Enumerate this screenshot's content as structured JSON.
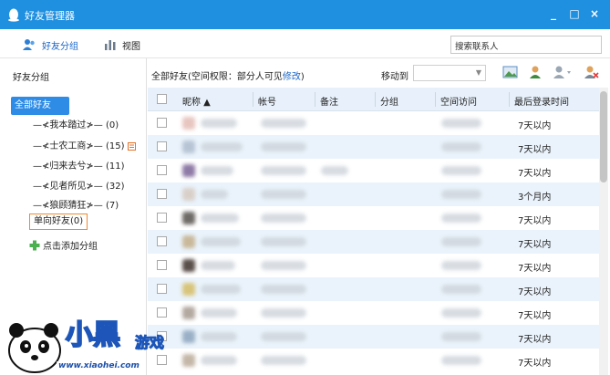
{
  "window": {
    "title": "好友管理器",
    "minimize": "_",
    "maximize": "□",
    "close": "×"
  },
  "toolbar": {
    "group_label": "好友分组",
    "view_label": "视图",
    "search_placeholder": "搜索联系人"
  },
  "sidebar": {
    "header": "好友分组",
    "all_friends": "全部好友(65)",
    "groups": [
      {
        "label": "—≮我本踏过≯—",
        "count": "(0)"
      },
      {
        "label": "—≮士农工商≯—",
        "count": "(15)"
      },
      {
        "label": "—≮归来去兮≯—",
        "count": "(11)"
      },
      {
        "label": "—≮见者所见≯—",
        "count": "(32)"
      },
      {
        "label": "—≮狼顾猜狂≯—",
        "count": "(7)"
      }
    ],
    "one_way": "单向好友(0)",
    "add_group": "点击添加分组"
  },
  "main": {
    "scope_prefix": "全部好友(空间权限：部分人可见",
    "scope_link": "修改",
    "scope_suffix": ")",
    "move_to": "移动到",
    "columns": {
      "nickname": "昵称 ▲",
      "account": "帐号",
      "remark": "备注",
      "group": "分组",
      "space": "空间访问",
      "last_login": "最后登录时间"
    },
    "rows": [
      {
        "last_login": "7天以内"
      },
      {
        "last_login": "7天以内"
      },
      {
        "last_login": "7天以内"
      },
      {
        "last_login": "3个月内"
      },
      {
        "last_login": "7天以内"
      },
      {
        "last_login": "7天以内"
      },
      {
        "last_login": "7天以内"
      },
      {
        "last_login": "7天以内"
      },
      {
        "last_login": "7天以内"
      },
      {
        "last_login": "7天以内"
      },
      {
        "last_login": "7天以内"
      }
    ]
  },
  "watermark": {
    "brand": "小黑",
    "sub": "游戏",
    "url": "www.xiaohei.com"
  },
  "colors": {
    "titlebar": "#1f8fe0",
    "selected": "#2e8ce6",
    "header_bg": "#e8f1fb",
    "highlight_border": "#f08a2c"
  }
}
